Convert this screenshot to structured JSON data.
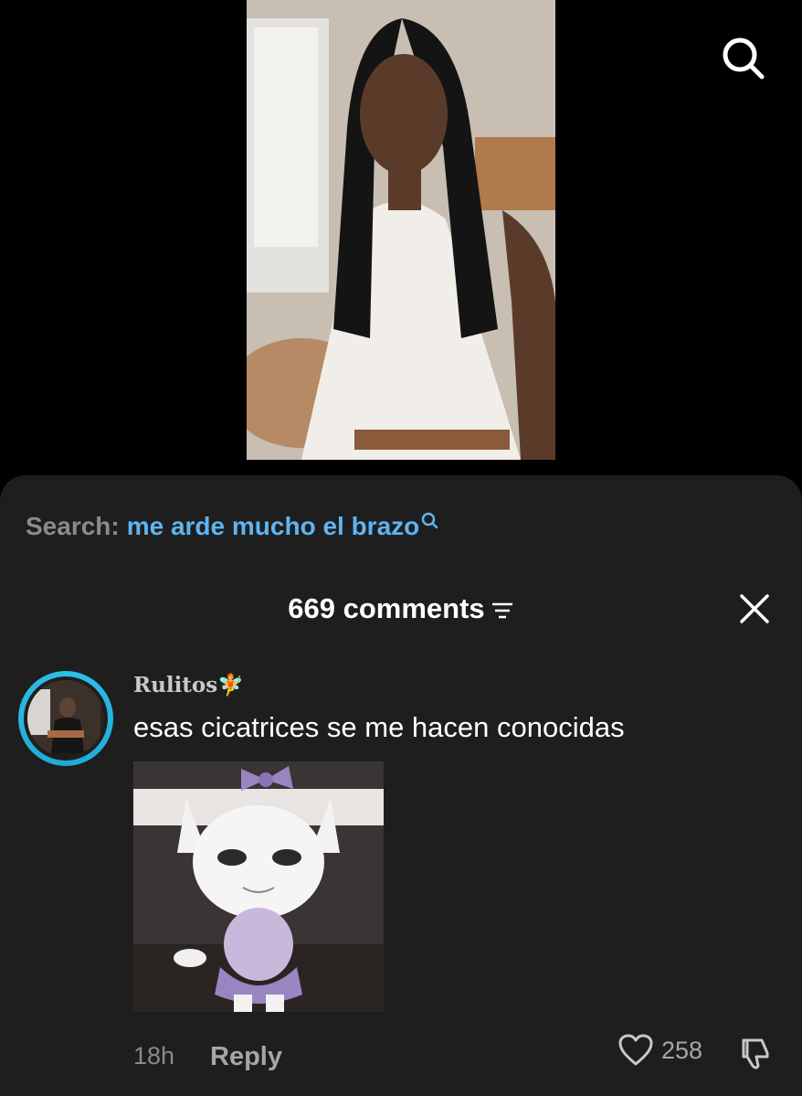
{
  "video": {
    "description_icon": "search-icon"
  },
  "sheet": {
    "search_prefix": "Search:",
    "search_query": "me arde mucho el brazo",
    "comments_title": "669 comments"
  },
  "comment": {
    "username": "Rulitos🧚",
    "text": "esas cicatrices se me hacen conocidas",
    "time": "18h",
    "reply_label": "Reply",
    "like_count": "258"
  },
  "colors": {
    "background": "#000000",
    "sheet": "#1e1e1e",
    "search_query": "#5fb4f2",
    "avatar_ring": "#2ec0e6"
  }
}
